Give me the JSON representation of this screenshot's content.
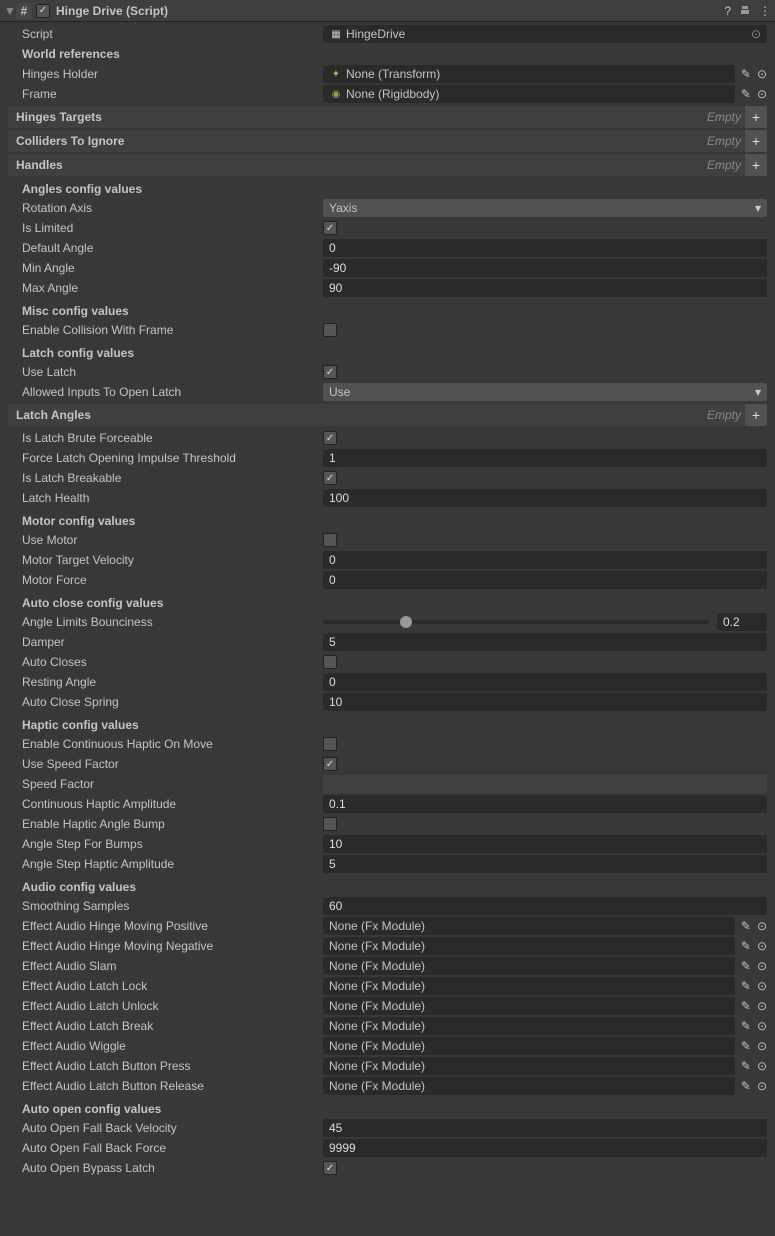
{
  "header": {
    "title": "Hinge Drive (Script)"
  },
  "script": {
    "label": "Script",
    "value": "HingeDrive"
  },
  "sections": {
    "world": "World references",
    "angles": "Angles config values",
    "misc": "Misc config values",
    "latch": "Latch config values",
    "motor": "Motor config values",
    "autoclose": "Auto close config values",
    "haptic": "Haptic config values",
    "audio": "Audio config values",
    "autoopen": "Auto open config values"
  },
  "world": {
    "hingesHolder": {
      "label": "Hinges Holder",
      "value": "None (Transform)"
    },
    "frame": {
      "label": "Frame",
      "value": "None (Rigidbody)"
    }
  },
  "lists": {
    "hingesTargets": {
      "label": "Hinges Targets",
      "empty": "Empty"
    },
    "collidersIgnore": {
      "label": "Colliders To Ignore",
      "empty": "Empty"
    },
    "handles": {
      "label": "Handles",
      "empty": "Empty"
    },
    "latchAngles": {
      "label": "Latch Angles",
      "empty": "Empty"
    }
  },
  "angles": {
    "rotationAxis": {
      "label": "Rotation Axis",
      "value": "Yaxis"
    },
    "isLimited": {
      "label": "Is Limited",
      "value": true
    },
    "defaultAngle": {
      "label": "Default Angle",
      "value": "0"
    },
    "minAngle": {
      "label": "Min Angle",
      "value": "-90"
    },
    "maxAngle": {
      "label": "Max Angle",
      "value": "90"
    }
  },
  "misc": {
    "enableCollision": {
      "label": "Enable Collision With Frame",
      "value": false
    }
  },
  "latch": {
    "useLatch": {
      "label": "Use Latch",
      "value": true
    },
    "allowedInputs": {
      "label": "Allowed Inputs To Open Latch",
      "value": "Use"
    },
    "bruteForce": {
      "label": "Is Latch Brute Forceable",
      "value": true
    },
    "impulse": {
      "label": "Force Latch Opening Impulse Threshold",
      "value": "1"
    },
    "breakable": {
      "label": "Is Latch Breakable",
      "value": true
    },
    "health": {
      "label": "Latch Health",
      "value": "100"
    }
  },
  "motor": {
    "useMotor": {
      "label": "Use Motor",
      "value": false
    },
    "targetVel": {
      "label": "Motor Target Velocity",
      "value": "0"
    },
    "force": {
      "label": "Motor Force",
      "value": "0"
    }
  },
  "autoclose": {
    "bounciness": {
      "label": "Angle Limits Bounciness",
      "value": "0.2"
    },
    "damper": {
      "label": "Damper",
      "value": "5"
    },
    "autoCloses": {
      "label": "Auto Closes",
      "value": false
    },
    "restingAngle": {
      "label": "Resting Angle",
      "value": "0"
    },
    "spring": {
      "label": "Auto Close Spring",
      "value": "10"
    }
  },
  "haptic": {
    "continuous": {
      "label": "Enable Continuous Haptic On Move",
      "value": false
    },
    "useSpeed": {
      "label": "Use Speed Factor",
      "value": true
    },
    "speedFactor": {
      "label": "Speed Factor",
      "value": ""
    },
    "amplitude": {
      "label": "Continuous Haptic Amplitude",
      "value": "0.1"
    },
    "angleBump": {
      "label": "Enable Haptic Angle Bump",
      "value": false
    },
    "stepBumps": {
      "label": "Angle Step For Bumps",
      "value": "10"
    },
    "stepAmplitude": {
      "label": "Angle Step Haptic Amplitude",
      "value": "5"
    }
  },
  "audio": {
    "samples": {
      "label": "Smoothing Samples",
      "value": "60"
    },
    "fx": "None (Fx Module)",
    "movePos": "Effect Audio Hinge Moving Positive",
    "moveNeg": "Effect Audio Hinge Moving Negative",
    "slam": "Effect Audio Slam",
    "lock": "Effect Audio Latch Lock",
    "unlock": "Effect Audio Latch Unlock",
    "break": "Effect Audio Latch Break",
    "wiggle": "Effect Audio Wiggle",
    "press": "Effect Audio Latch Button Press",
    "release": "Effect Audio Latch Button Release"
  },
  "autoopen": {
    "velocity": {
      "label": "Auto Open Fall Back Velocity",
      "value": "45"
    },
    "force": {
      "label": "Auto Open Fall Back Force",
      "value": "9999"
    },
    "bypass": {
      "label": "Auto Open Bypass Latch",
      "value": true
    }
  }
}
